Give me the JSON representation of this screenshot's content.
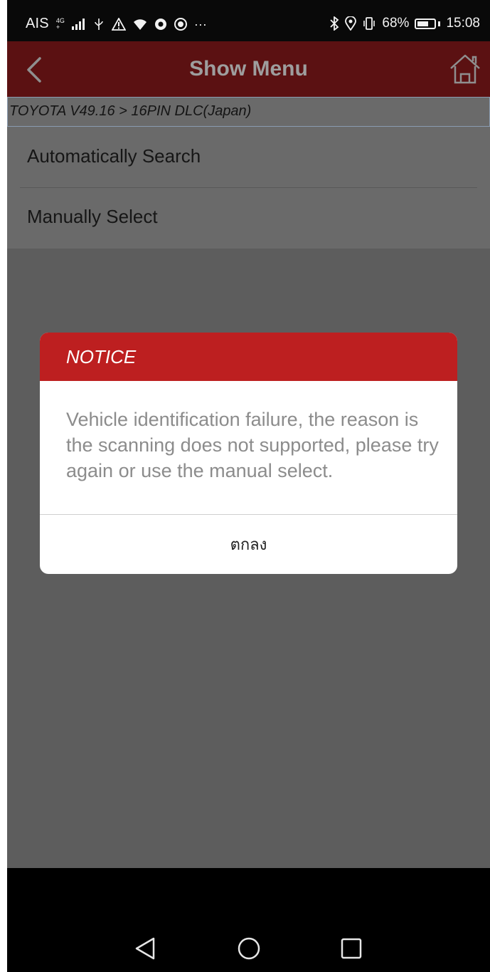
{
  "status_bar": {
    "carrier": "AIS",
    "network_type_top": "4G",
    "network_type_bottom": "+",
    "overflow": "···",
    "battery_level": "68%",
    "battery_fraction": 0.68,
    "time": "15:08",
    "icons": [
      "signal-icon",
      "usb-icon",
      "warning-icon",
      "wifi-icon",
      "chrome-icon",
      "app-icon",
      "bluetooth-icon",
      "location-icon",
      "vibrate-icon",
      "battery-icon"
    ]
  },
  "header": {
    "title": "Show Menu",
    "back_icon": "chevron-left-icon",
    "home_icon": "home-icon"
  },
  "breadcrumb": {
    "text": "TOYOTA V49.16 > 16PIN DLC(Japan)"
  },
  "menu": {
    "items": [
      {
        "label": "Automatically Search"
      },
      {
        "label": "Manually Select"
      }
    ]
  },
  "dialog": {
    "title": "NOTICE",
    "message": "Vehicle identification failure, the reason is the scanning does not supported, please try again or use the manual select.",
    "ok_label": "ตกลง"
  },
  "nav_bar": {
    "icons": [
      "back-triangle-icon",
      "home-circle-icon",
      "recents-square-icon"
    ]
  },
  "colors": {
    "header_bg": "#5b1112",
    "dialog_header_bg": "#bd1f20",
    "overlay_bg": "#5d5d5d"
  }
}
